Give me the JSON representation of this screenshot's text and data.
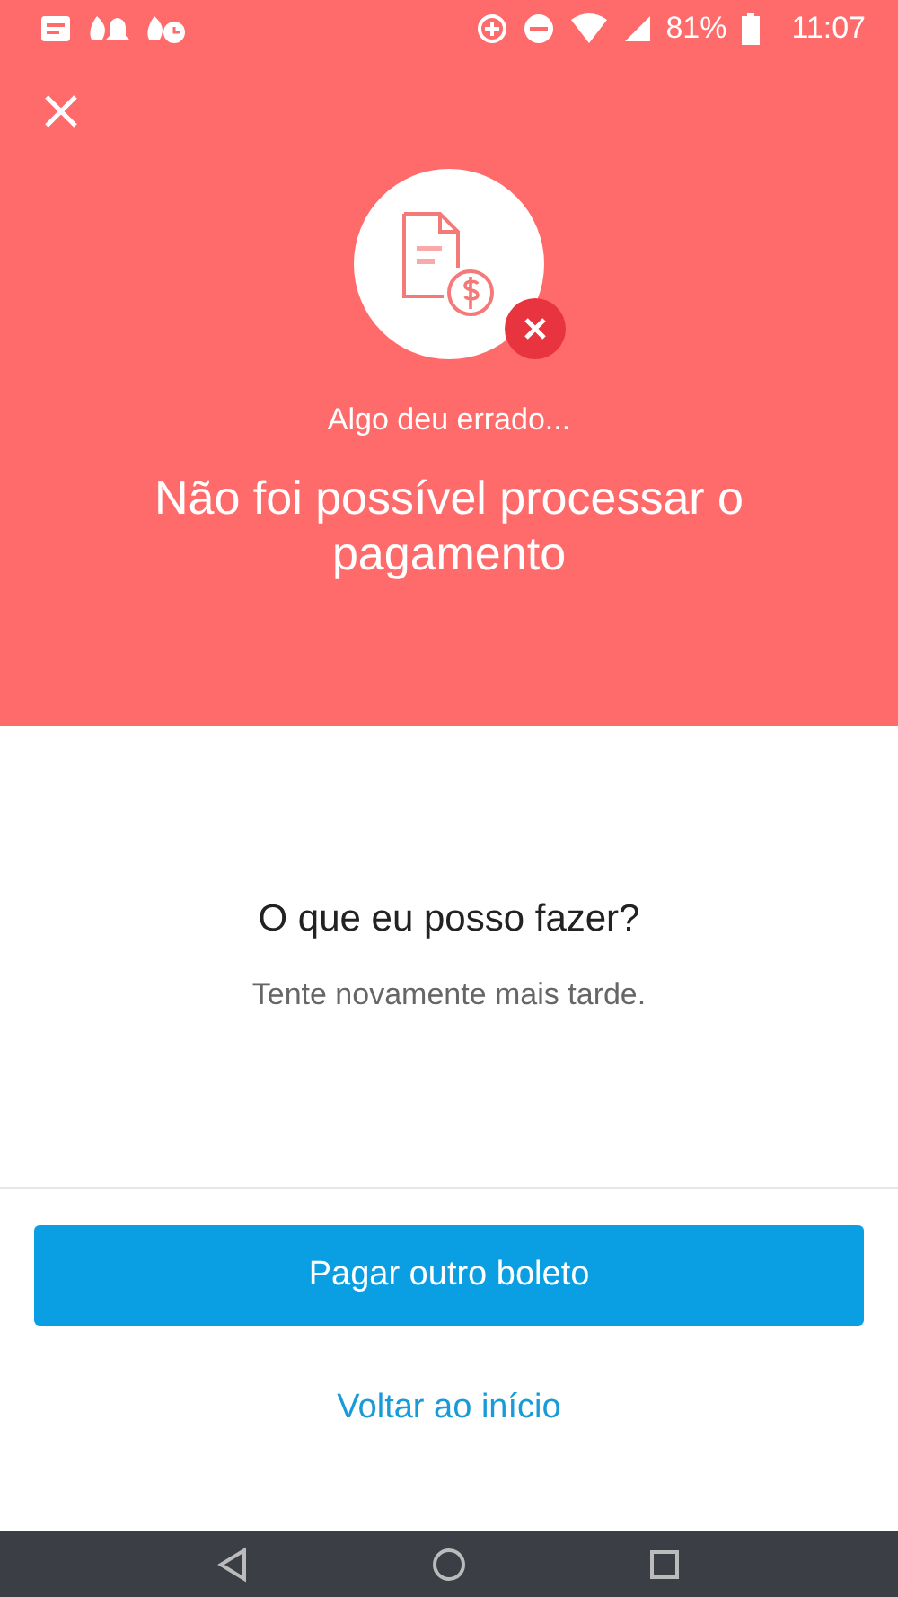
{
  "status_bar": {
    "battery": "81%",
    "time": "11:07"
  },
  "header": {
    "subtitle": "Algo deu errado...",
    "title": "Não foi possível processar o pagamento"
  },
  "help": {
    "question": "O que eu posso fazer?",
    "answer": "Tente novamente mais tarde."
  },
  "actions": {
    "primary": "Pagar outro boleto",
    "secondary": "Voltar ao início"
  }
}
